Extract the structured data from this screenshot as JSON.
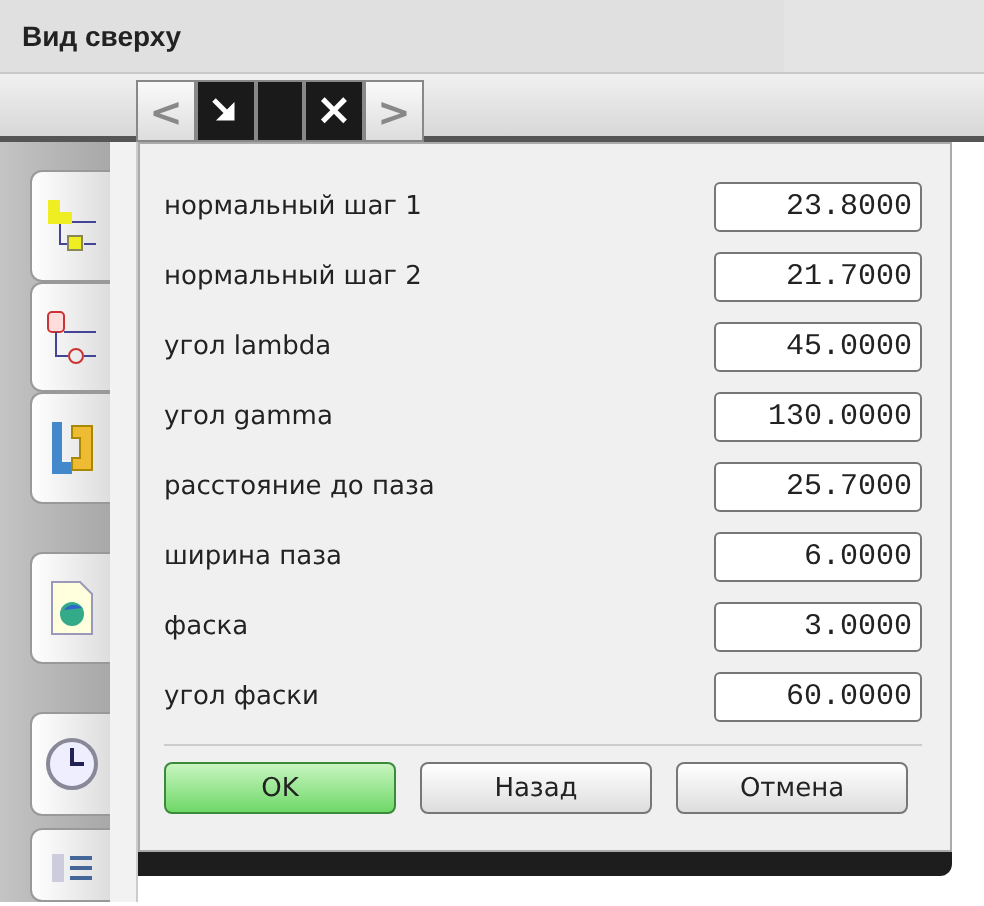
{
  "window": {
    "title": "Вид сверху"
  },
  "toolbar": {
    "prev": "<",
    "close": "×",
    "next": ">"
  },
  "params": [
    {
      "label": "нормальный шаг 1",
      "value": "23.8000"
    },
    {
      "label": "нормальный шаг 2",
      "value": "21.7000"
    },
    {
      "label": "угол lambda",
      "value": "45.0000"
    },
    {
      "label": "угол gamma",
      "value": "130.0000"
    },
    {
      "label": "расстояние до паза",
      "value": "25.7000"
    },
    {
      "label": "ширина паза",
      "value": "6.0000"
    },
    {
      "label": "фаска",
      "value": "3.0000"
    },
    {
      "label": "угол фаски",
      "value": "60.0000"
    }
  ],
  "buttons": [
    {
      "label": "OK",
      "kind": "primary"
    },
    {
      "label": "Назад",
      "kind": "normal"
    },
    {
      "label": "Отмена",
      "kind": "normal"
    }
  ]
}
